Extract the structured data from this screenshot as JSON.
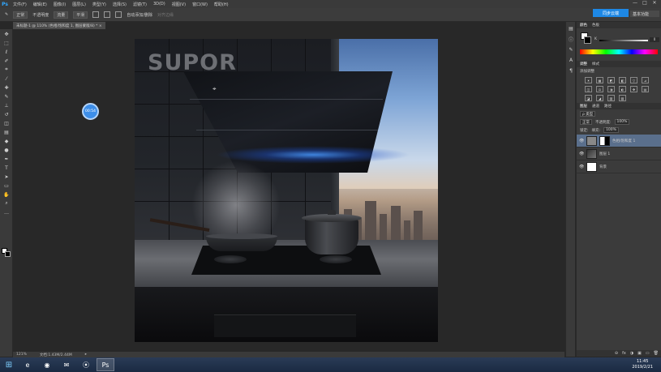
{
  "app": {
    "logo": "Ps",
    "menus": [
      "文件(F)",
      "编辑(E)",
      "图像(I)",
      "图层(L)",
      "类型(Y)",
      "选择(S)",
      "滤镜(T)",
      "3D(D)",
      "视图(V)",
      "窗口(W)",
      "帮助(H)"
    ],
    "window_controls": [
      "—",
      "□",
      "✕"
    ]
  },
  "options_bar": {
    "tool_preset": "✎",
    "mode_label": "模式",
    "mode_value": "正常",
    "opacity_label": "不透明度",
    "flow_label": "流量",
    "smoothing_label": "平滑",
    "auto_add_label": "自动添加/删除",
    "align_edges_label": "对齐边缘",
    "cloud_label": "同步云端",
    "workspace_label": "基本功能"
  },
  "document": {
    "tab_title": "未标题-1 @ 110% (色相/饱和度 1, 图层蒙版/8) * ×"
  },
  "canvas": {
    "brand": "SUPOR",
    "badge_text": "00:54"
  },
  "status": {
    "zoom": "121%",
    "doc_info": "文档:1.43M/2.44M",
    "arrow": "▸"
  },
  "panels": {
    "color_tabs": [
      "颜色",
      "色板"
    ],
    "slider_label": "K",
    "slider_value": "0",
    "adj_tabs": [
      "调整",
      "样式"
    ],
    "adj_title": "添加调整",
    "adj_icons": [
      "☀",
      "▦",
      "◩",
      "◧",
      "▽",
      "⊿",
      "◫",
      "⚖",
      "◑",
      "◐",
      "❖",
      "▤",
      "◪",
      "◢",
      "▥",
      "▨"
    ],
    "layer_tabs": [
      "图层",
      "通道",
      "路径"
    ],
    "kind_label": "ρ 类型",
    "blend_mode": "正常",
    "opacity_label": "不透明度:",
    "opacity_value": "100%",
    "lock_label": "锁定:",
    "fill_label": "填充:",
    "fill_value": "100%",
    "layers": [
      {
        "name": "色相/饱和度 1",
        "selected": true
      },
      {
        "name": "图层 1",
        "selected": false
      },
      {
        "name": "背景",
        "selected": false
      }
    ],
    "footer_icons": [
      "⊖",
      "fx",
      "◑",
      "▣",
      "▭",
      "🗑"
    ]
  },
  "taskbar": {
    "start": "⊞",
    "apps": [
      "e",
      "◉",
      "✉",
      "⦿",
      "Ps"
    ],
    "time": "11:45",
    "date": "2019/2/21"
  }
}
